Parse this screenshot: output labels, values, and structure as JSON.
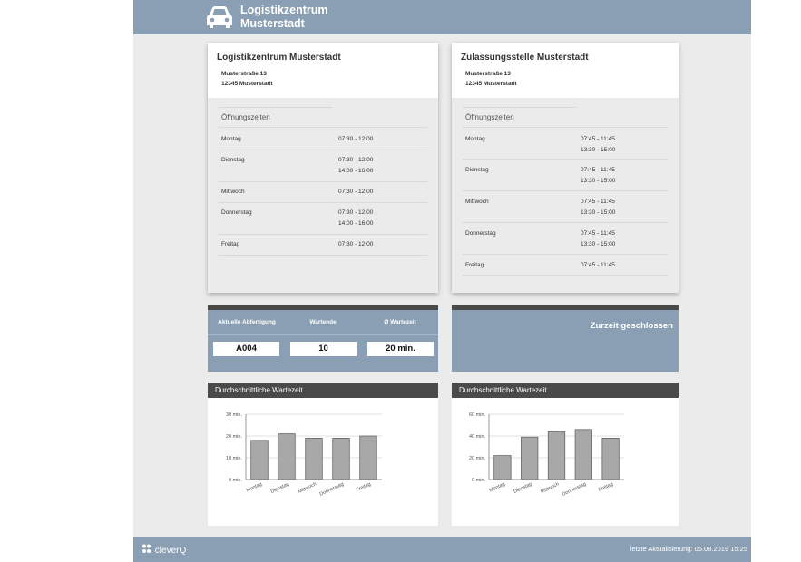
{
  "header": {
    "brand_line1": "Logistikzentrum",
    "brand_line2": "Musterstadt",
    "icon": "car-icon",
    "color": "#8a9fb3"
  },
  "locations": [
    {
      "name": "Logistikzentrum Musterstadt",
      "street": "Musterstraße 13",
      "city": "12345 Musterstadt",
      "hours_title": "Öffnungszeiten",
      "days": [
        {
          "day": "Montag",
          "hours": [
            "07:30 - 12:00"
          ]
        },
        {
          "day": "Dienstag",
          "hours": [
            "07:30 - 12:00",
            "14:00 - 16:00"
          ]
        },
        {
          "day": "Mittwoch",
          "hours": [
            "07:30 - 12:00"
          ]
        },
        {
          "day": "Donnerstag",
          "hours": [
            "07:30 - 12:00",
            "14:00 - 16:00"
          ]
        },
        {
          "day": "Freitag",
          "hours": [
            "07:30 - 12:00"
          ]
        }
      ]
    },
    {
      "name": "Zulassungsstelle Musterstadt",
      "street": "Musterstraße 13",
      "city": "12345 Musterstadt",
      "hours_title": "Öffnungszeiten",
      "days": [
        {
          "day": "Montag",
          "hours": [
            "07:45 - 11:45",
            "13:30 - 15:00"
          ]
        },
        {
          "day": "Dienstag",
          "hours": [
            "07:45 - 11:45",
            "13:30 - 15:00"
          ]
        },
        {
          "day": "Mittwoch",
          "hours": [
            "07:45 - 11:45",
            "13:30 - 15:00"
          ]
        },
        {
          "day": "Donnerstag",
          "hours": [
            "07:45 - 11:45",
            "13:30 - 15:00"
          ]
        },
        {
          "day": "Freitag",
          "hours": [
            "07:45 - 11:45"
          ]
        }
      ]
    }
  ],
  "status_left": {
    "labels": [
      "Aktuelle Abfertigung",
      "Wartende",
      "Ø Wartezeit"
    ],
    "values": [
      "A004",
      "10",
      "20 min."
    ]
  },
  "status_right": {
    "message": "Zurzeit geschlossen"
  },
  "chart_data": [
    {
      "type": "bar",
      "title": "Durchschnittliche Wartezeit",
      "categories": [
        "Montag",
        "Dienstag",
        "Mittwoch",
        "Donnerstag",
        "Freitag"
      ],
      "values": [
        18,
        21,
        19,
        19,
        20
      ],
      "ylim": [
        0,
        30
      ],
      "yticks": [
        0,
        10,
        20,
        30
      ],
      "ytick_labels": [
        "0 min.",
        "10 min.",
        "20 min.",
        "30 min."
      ],
      "xlabel": "",
      "ylabel": "",
      "grid": true,
      "bar_color": "#a8a8a8"
    },
    {
      "type": "bar",
      "title": "Durchschnittliche Wartezeit",
      "categories": [
        "Montag",
        "Dienstag",
        "Mittwoch",
        "Donnerstag",
        "Freitag"
      ],
      "values": [
        22,
        39,
        44,
        46,
        38
      ],
      "ylim": [
        0,
        60
      ],
      "yticks": [
        0,
        20,
        40,
        60
      ],
      "ytick_labels": [
        "0 min.",
        "20 min.",
        "40 min.",
        "60 min."
      ],
      "xlabel": "",
      "ylabel": "",
      "grid": true,
      "bar_color": "#a8a8a8"
    }
  ],
  "footer": {
    "logo": "cleverQ",
    "update": "letzte Aktualisierung: 05.08.2019 15:25"
  }
}
